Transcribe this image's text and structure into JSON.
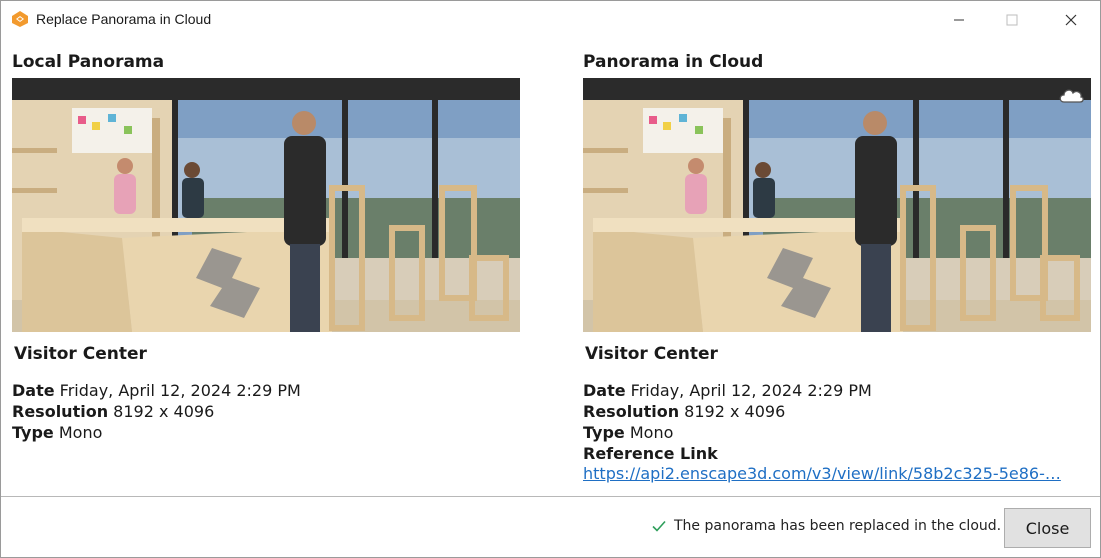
{
  "window": {
    "title": "Replace Panorama in Cloud",
    "controls": [
      "minimize-icon",
      "maximize-icon",
      "close-icon"
    ]
  },
  "local": {
    "heading": "Local Panorama",
    "name": "Visitor Center",
    "date_label": "Date",
    "date_value": "Friday, April 12, 2024 2:29 PM",
    "resolution_label": "Resolution",
    "resolution_value": "8192 x 4096",
    "type_label": "Type",
    "type_value": "Mono"
  },
  "cloud": {
    "heading": "Panorama in Cloud",
    "badge_icon": "cloud-icon",
    "name": "Visitor Center",
    "date_label": "Date",
    "date_value": "Friday, April 12, 2024 2:29 PM",
    "resolution_label": "Resolution",
    "resolution_value": "8192 x 4096",
    "type_label": "Type",
    "type_value": "Mono",
    "reference_label": "Reference Link",
    "reference_link": "https://api2.enscape3d.com/v3/view/link/58b2c325-5e86-…"
  },
  "footer": {
    "status_icon": "check-icon",
    "status_text": "The panorama has been replaced in the cloud.",
    "close_label": "Close"
  },
  "colors": {
    "accent_orange": "#f29a2e",
    "link_blue": "#1f6fc4",
    "success_green": "#2e9e5b"
  }
}
